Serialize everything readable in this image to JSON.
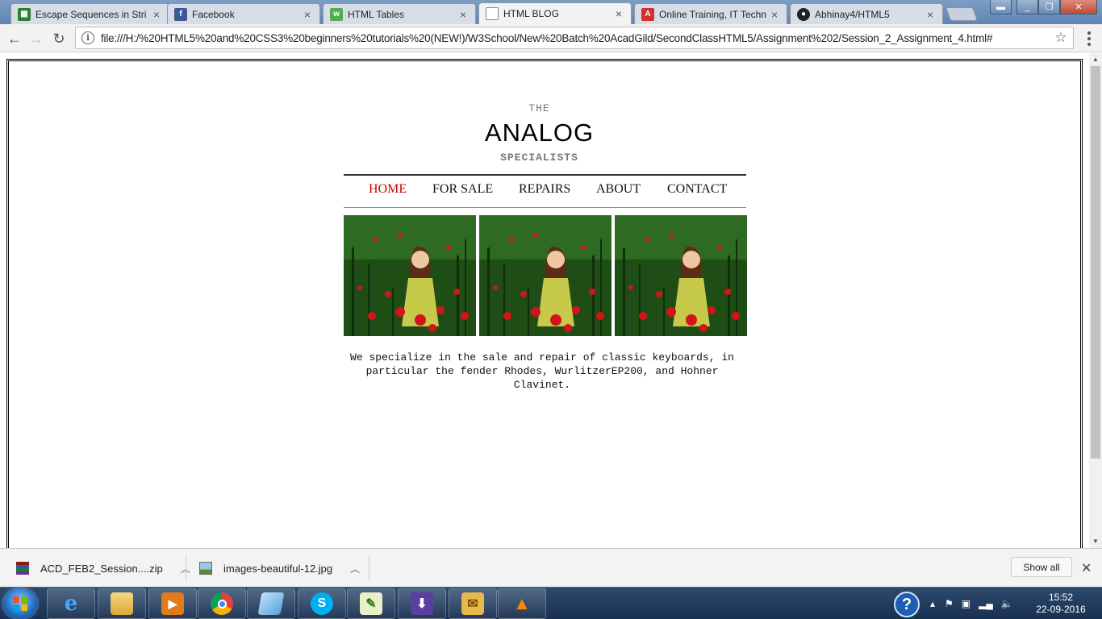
{
  "browser": {
    "tabs": [
      {
        "title": "Escape Sequences in Stri",
        "icon": "spreadsheet-icon",
        "color": "#2e7d32"
      },
      {
        "title": "Facebook",
        "icon": "facebook-icon",
        "color": "#3b5998"
      },
      {
        "title": "HTML Tables",
        "icon": "w3-icon",
        "color": "#4caf50"
      },
      {
        "title": "HTML BLOG",
        "icon": "page-icon",
        "color": "#777777"
      },
      {
        "title": "Online Training, IT Techn",
        "icon": "acadgild-icon",
        "color": "#d32f2f"
      },
      {
        "title": "Abhinay4/HTML5",
        "icon": "github-icon",
        "color": "#222222"
      }
    ],
    "address": "file:///H:/%20HTML5%20and%20CSS3%20beginners%20tutorials%20(NEW!)/W3School/New%20Batch%20AcadGild/SecondClassHTML5/Assignment%202/Session_2_Assignment_4.html#"
  },
  "page": {
    "brand_the": "THE",
    "brand_name": "ANALOG",
    "brand_sub": "SPECIALISTS",
    "nav": [
      "HOME",
      "FOR SALE",
      "REPAIRS",
      "ABOUT",
      "CONTACT"
    ],
    "active_nav": "HOME",
    "accent_color": "#cc0000",
    "description": "We specialize in the sale and repair of classic keyboards, in particular the fender Rhodes, WurlitzerEP200, and Hohner Clavinet."
  },
  "downloads": {
    "items": [
      "ACD_FEB2_Session....zip",
      "images-beautiful-12.jpg"
    ],
    "show_all": "Show all"
  },
  "taskbar": {
    "time": "15:52",
    "date": "22-09-2016"
  }
}
